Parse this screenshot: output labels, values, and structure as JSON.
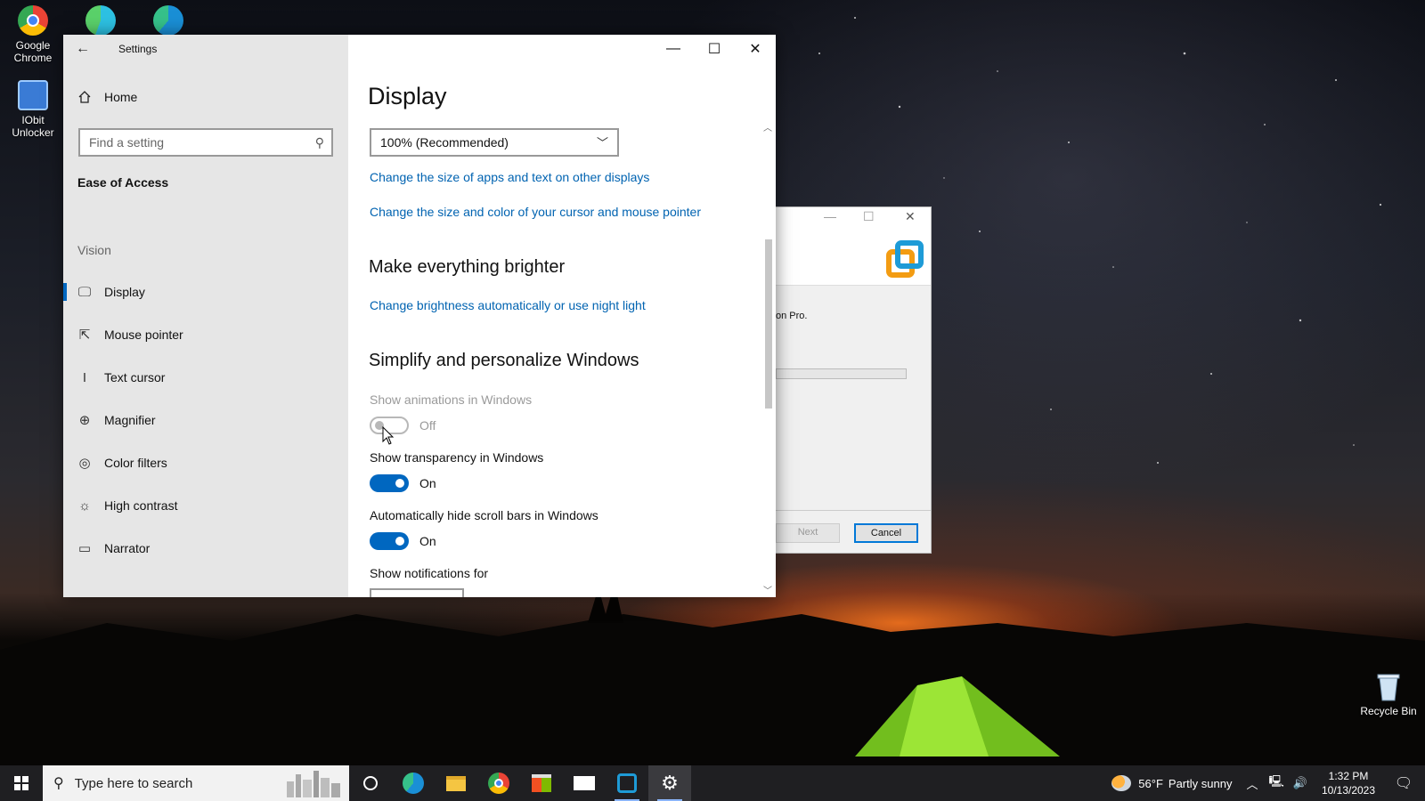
{
  "desktop": {
    "icons": [
      {
        "label_line1": "Google",
        "label_line2": "Chrome"
      },
      {
        "label_line1": "IObit",
        "label_line2": "Unlocker"
      }
    ],
    "recycle_bin": "Recycle Bin"
  },
  "settings": {
    "app_title": "Settings",
    "home": "Home",
    "search_placeholder": "Find a setting",
    "section": "Ease of Access",
    "group": "Vision",
    "nav": [
      {
        "label": "Display",
        "icon": "monitor-icon"
      },
      {
        "label": "Mouse pointer",
        "icon": "mouse-pointer-icon"
      },
      {
        "label": "Text cursor",
        "icon": "text-cursor-icon"
      },
      {
        "label": "Magnifier",
        "icon": "magnifier-icon"
      },
      {
        "label": "Color filters",
        "icon": "color-filters-icon"
      },
      {
        "label": "High contrast",
        "icon": "high-contrast-icon"
      },
      {
        "label": "Narrator",
        "icon": "narrator-icon"
      }
    ],
    "active_nav": "Display",
    "page_title": "Display",
    "scale_value": "100% (Recommended)",
    "links": {
      "other_displays": "Change the size of apps and text on other displays",
      "cursor": "Change the size and color of your cursor and mouse pointer",
      "brightness": "Change brightness automatically or use night light"
    },
    "headings": {
      "brighter": "Make everything brighter",
      "simplify": "Simplify and personalize Windows"
    },
    "toggles": [
      {
        "label": "Show animations in Windows",
        "state": "Off",
        "on": false,
        "disabled": true
      },
      {
        "label": "Show transparency in Windows",
        "state": "On",
        "on": true,
        "disabled": false
      },
      {
        "label": "Automatically hide scroll bars in Windows",
        "state": "On",
        "on": true,
        "disabled": false
      }
    ],
    "notifications_label": "Show notifications for"
  },
  "installer": {
    "body_text": "on Pro.",
    "next": "Next",
    "cancel": "Cancel"
  },
  "taskbar": {
    "search_placeholder": "Type here to search",
    "weather_temp": "56°F",
    "weather_desc": "Partly sunny",
    "time": "1:32 PM",
    "date": "10/13/2023"
  },
  "colors": {
    "accent": "#0067c0",
    "link": "#0063b1",
    "sidebar_bg": "#e6e6e6",
    "taskbar_bg": "#1f1f22"
  }
}
